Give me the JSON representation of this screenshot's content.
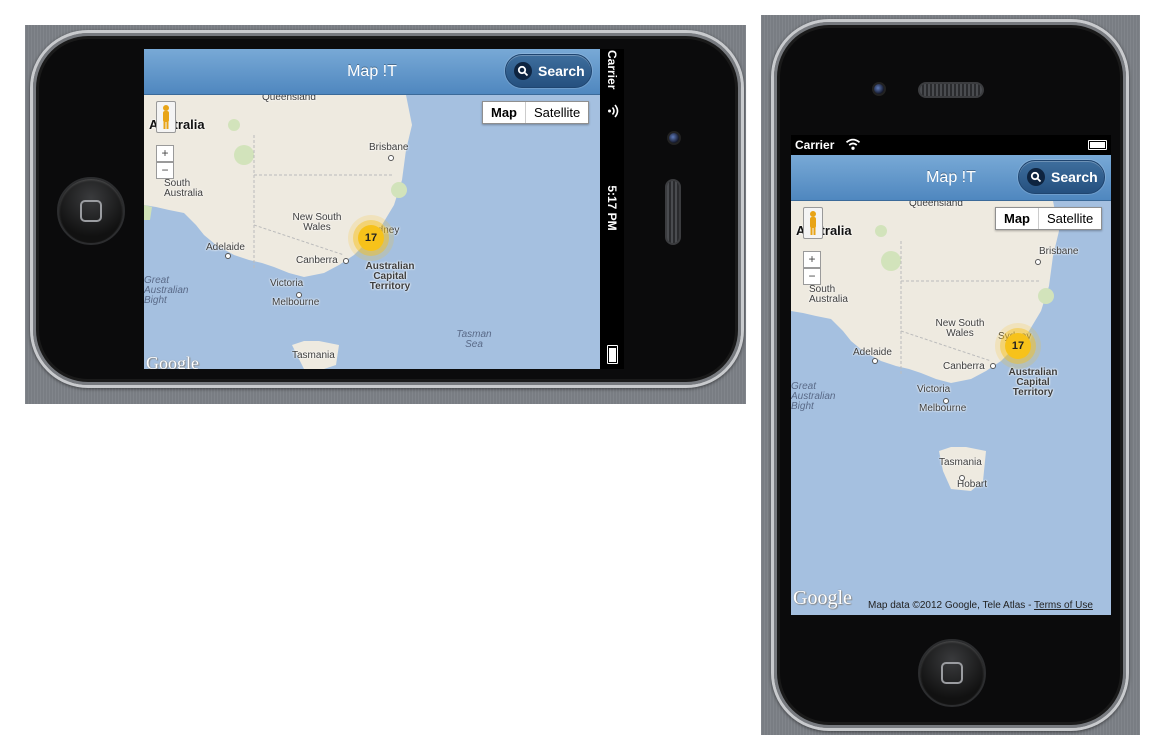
{
  "app": {
    "title": "Map !T",
    "search_label": "Search"
  },
  "status": {
    "carrier": "Carrier",
    "time": "5:17 PM"
  },
  "map": {
    "type_options": [
      "Map",
      "Satellite"
    ],
    "selected_type": "Map",
    "zoom_in": "+",
    "zoom_out": "−",
    "cluster_count": "17",
    "labels": {
      "queensland": "Queensland",
      "australia": "Australia",
      "brisbane": "Brisbane",
      "south_australia": "South Australia",
      "new_south_wales": "New South Wales",
      "sydney": "Sydney",
      "adelaide": "Adelaide",
      "canberra": "Canberra",
      "act": "Australian Capital Territory",
      "great_australian_bight": "Great Australian Bight",
      "victoria": "Victoria",
      "melbourne": "Melbourne",
      "tasman_sea": "Tasman Sea",
      "tasmania": "Tasmania",
      "hobart": "Hobart"
    },
    "logo": "Google",
    "attribution": "Map data ©2012 Google, Tele Atlas -",
    "terms": "Terms of Use"
  },
  "colors": {
    "navbar": "#5a8fc6",
    "water": "#a5c0e0",
    "land": "#eeeae0",
    "cluster": "#f7c21a"
  }
}
